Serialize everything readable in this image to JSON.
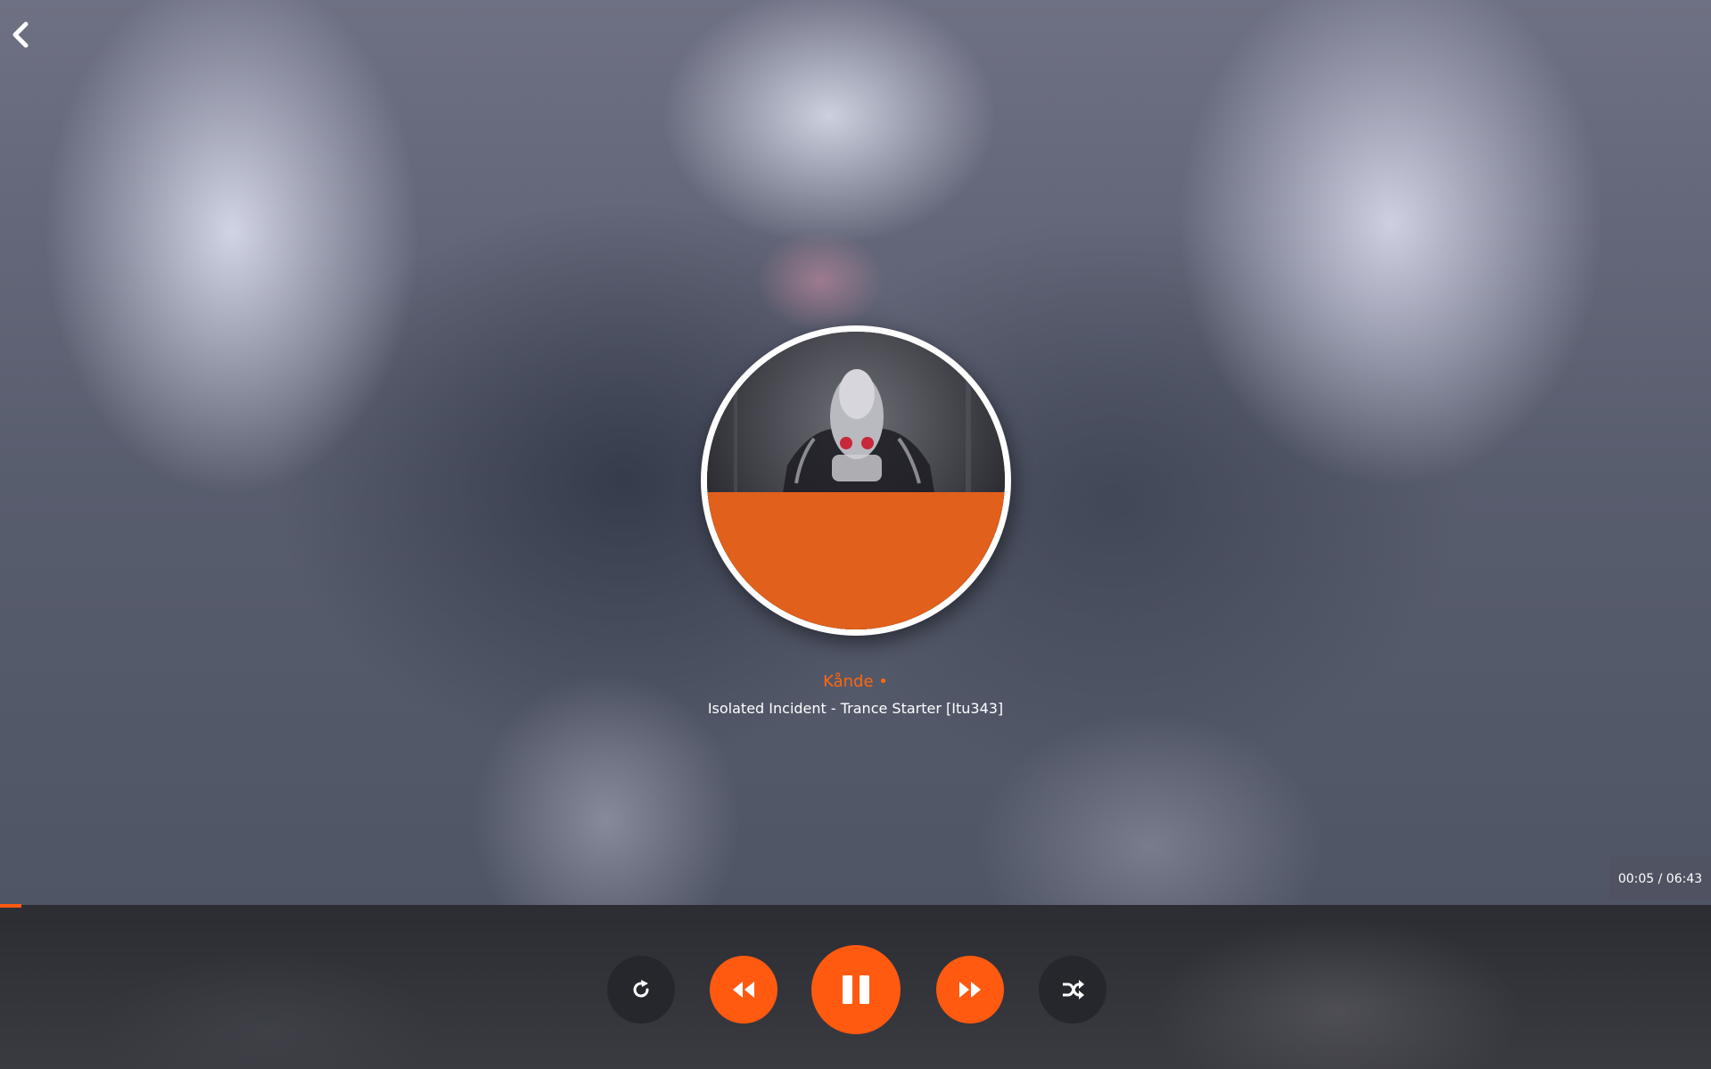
{
  "player": {
    "artist": "Kånde •",
    "track_title": "Isolated Incident - Trance Starter [Itu343]",
    "time_display": "00:05 / 06:43",
    "progress_fraction": 0.0125,
    "art_fill_fraction": 0.46
  },
  "icons": {
    "back": "chevron-left-icon",
    "repeat": "repeat-icon",
    "previous": "rewind-icon",
    "play_pause": "pause-icon",
    "next": "fast-forward-icon",
    "shuffle": "shuffle-icon"
  },
  "colors": {
    "accent": "#ff5a10",
    "art_overlay": "#e0601c",
    "control_bar": "#2b2d33",
    "dark_button": "#26272c"
  }
}
